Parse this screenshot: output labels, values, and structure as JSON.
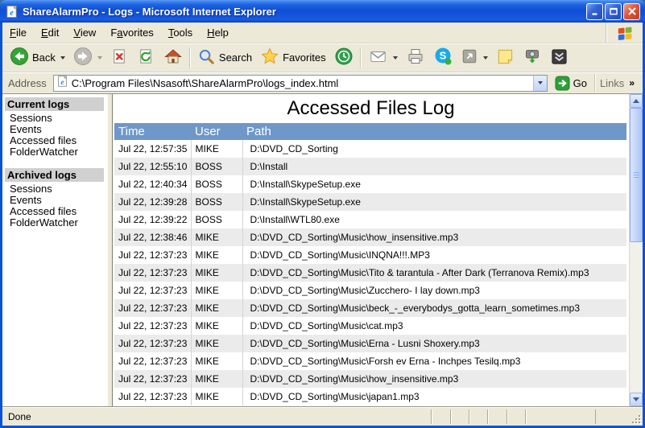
{
  "window": {
    "title": "ShareAlarmPro - Logs - Microsoft Internet Explorer",
    "status": "Done"
  },
  "menu": {
    "items": [
      {
        "label": "File",
        "underline": 0
      },
      {
        "label": "Edit",
        "underline": 0
      },
      {
        "label": "View",
        "underline": 0
      },
      {
        "label": "Favorites",
        "underline": 1
      },
      {
        "label": "Tools",
        "underline": 0
      },
      {
        "label": "Help",
        "underline": 0
      }
    ]
  },
  "toolbar": {
    "back_label": "Back",
    "search_label": "Search",
    "favorites_label": "Favorites",
    "icons": [
      "back-icon",
      "forward-icon",
      "stop-icon",
      "refresh-icon",
      "home-icon",
      "search-icon",
      "favorites-icon",
      "history-icon",
      "mail-icon",
      "print-icon",
      "skype-icon",
      "fullscreen-icon",
      "notes-icon",
      "snapshot-icon",
      "downloads-icon"
    ]
  },
  "address_bar": {
    "label": "Address",
    "value": "C:\\Program Files\\Nsasoft\\ShareAlarmPro\\logs_index.html",
    "go_label": "Go",
    "links_label": "Links",
    "links_chevron": "»"
  },
  "sidebar": {
    "sections": [
      {
        "title": "Current logs",
        "items": [
          "Sessions",
          "Events",
          "Accessed files",
          "FolderWatcher"
        ]
      },
      {
        "title": "Archived logs",
        "items": [
          "Sessions",
          "Events",
          "Accessed files",
          "FolderWatcher"
        ]
      }
    ]
  },
  "main": {
    "title": "Accessed Files Log",
    "table": {
      "headers": [
        "Time",
        "User",
        "Path"
      ],
      "rows": [
        [
          "Jul 22, 12:57:35",
          "MIKE",
          "D:\\DVD_CD_Sorting"
        ],
        [
          "Jul 22, 12:55:10",
          "BOSS",
          "D:\\Install"
        ],
        [
          "Jul 22, 12:40:34",
          "BOSS",
          "D:\\Install\\SkypeSetup.exe"
        ],
        [
          "Jul 22, 12:39:28",
          "BOSS",
          "D:\\Install\\SkypeSetup.exe"
        ],
        [
          "Jul 22, 12:39:22",
          "BOSS",
          "D:\\Install\\WTL80.exe"
        ],
        [
          "Jul 22, 12:38:46",
          "MIKE",
          "D:\\DVD_CD_Sorting\\Music\\how_insensitive.mp3"
        ],
        [
          "Jul 22, 12:37:23",
          "MIKE",
          "D:\\DVD_CD_Sorting\\Music\\INQNA!!!.MP3"
        ],
        [
          "Jul 22, 12:37:23",
          "MIKE",
          "D:\\DVD_CD_Sorting\\Music\\Tito & tarantula - After Dark (Terranova Remix).mp3"
        ],
        [
          "Jul 22, 12:37:23",
          "MIKE",
          "D:\\DVD_CD_Sorting\\Music\\Zucchero- I lay down.mp3"
        ],
        [
          "Jul 22, 12:37:23",
          "MIKE",
          "D:\\DVD_CD_Sorting\\Music\\beck_-_everybodys_gotta_learn_sometimes.mp3"
        ],
        [
          "Jul 22, 12:37:23",
          "MIKE",
          "D:\\DVD_CD_Sorting\\Music\\cat.mp3"
        ],
        [
          "Jul 22, 12:37:23",
          "MIKE",
          "D:\\DVD_CD_Sorting\\Music\\Erna - Lusni Shoxery.mp3"
        ],
        [
          "Jul 22, 12:37:23",
          "MIKE",
          "D:\\DVD_CD_Sorting\\Music\\Forsh ev Erna - Inchpes Tesilq.mp3"
        ],
        [
          "Jul 22, 12:37:23",
          "MIKE",
          "D:\\DVD_CD_Sorting\\Music\\how_insensitive.mp3"
        ],
        [
          "Jul 22, 12:37:23",
          "MIKE",
          "D:\\DVD_CD_Sorting\\Music\\japan1.mp3"
        ]
      ]
    }
  },
  "colors": {
    "frame_blue": "#0A52D6",
    "chrome_beige": "#ECE9D8",
    "close_red": "#C33D1D",
    "table_header_bg": "#6F97C8",
    "table_header_text": "#FFFFFF",
    "row_alt_bg": "#EBEBEB",
    "sidebar_header_bg": "#D0D0D0",
    "go_green": "#2E9E38"
  }
}
